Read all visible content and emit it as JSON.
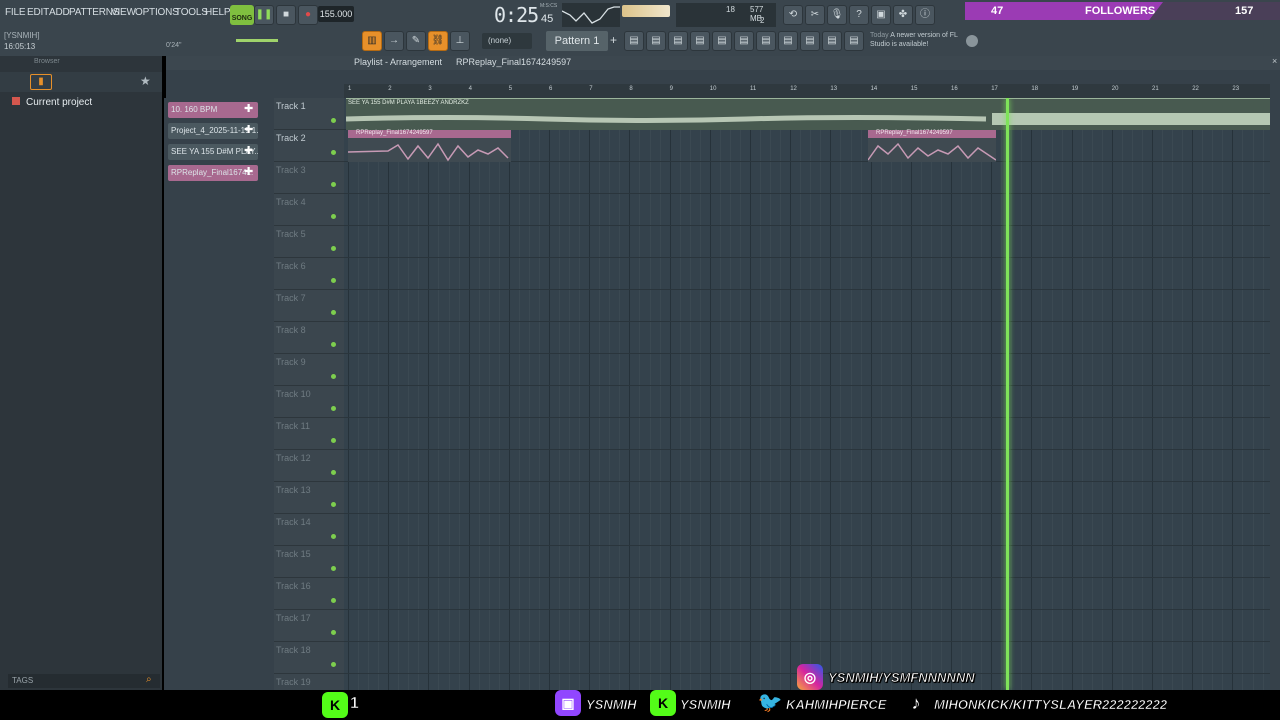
{
  "menu": [
    "FILE",
    "EDIT",
    "ADD",
    "PATTERNS",
    "VIEW",
    "OPTIONS",
    "TOOLS",
    "HELP"
  ],
  "transport": {
    "mode": "SONG",
    "tempo": "155.000",
    "time": "0:25",
    "time_small": "45",
    "time_unit": "M:S:CS"
  },
  "cpu": {
    "value": "18",
    "mem": "577 MB",
    "voices": "2"
  },
  "hint": {
    "label": "(none)",
    "pattern": "Pattern 1",
    "today": "Today",
    "notice": "A newer version of FL Studio is available!"
  },
  "followers": {
    "count": "47",
    "label": "FOLLOWERS",
    "goal": "157"
  },
  "project_info": {
    "user": "[YSNMIH]",
    "clock": "16:05:13",
    "duration": "0'24\""
  },
  "browser": {
    "title": "Browser",
    "item": "Current project",
    "tags": "TAGS"
  },
  "playlist": {
    "title": "Playlist - Arrangement",
    "breadcrumb": "RPReplay_Final1674249597"
  },
  "channels": [
    {
      "label": "10. 160 BPM",
      "pink": true
    },
    {
      "label": "Project_4_2025-11-19 1...",
      "pink": false
    },
    {
      "label": "SEE YA 155 D#M PLAY...",
      "pink": false
    },
    {
      "label": "RPReplay_Final1674...",
      "pink": true
    }
  ],
  "ruler": [
    "1",
    "2",
    "3",
    "4",
    "5",
    "6",
    "7",
    "8",
    "9",
    "10",
    "11",
    "12",
    "13",
    "14",
    "15",
    "16",
    "17",
    "18",
    "19",
    "20",
    "21",
    "22",
    "23"
  ],
  "tracks": [
    "Track 1",
    "Track 2",
    "Track 3",
    "Track 4",
    "Track 5",
    "Track 6",
    "Track 7",
    "Track 8",
    "Track 9",
    "Track 10",
    "Track 11",
    "Track 12",
    "Track 13",
    "Track 14",
    "Track 15",
    "Track 16",
    "Track 17",
    "Track 18",
    "Track 19"
  ],
  "clips": {
    "audio1": "SEE YA 155 D#M PLAYA 1BEEZY ANDRZKZ",
    "audio2": "RPReplay_Final1674249597",
    "audio3": "RPReplay_Final1674249597"
  },
  "overlay": {
    "kick_count": "1",
    "instagram": "YSNMIH/YSMFNNNNNN",
    "twitch": "YSNMIH",
    "kick": "YSNMIH",
    "twitter": "KAHMIHPIERCE",
    "tiktok": "MIHONKICK/KITTYSLAYER222222222"
  },
  "colors": {
    "accent": "#e7902a",
    "playhead": "#7fe35a",
    "pinkClip": "#a8698f",
    "audioClip": "#8fa58f"
  }
}
